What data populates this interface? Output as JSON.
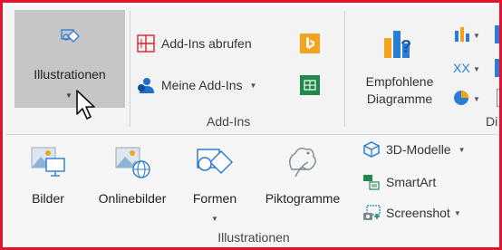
{
  "ribbon": {
    "illustrations_button": {
      "label": "Illustrationen",
      "icon": "illustration-icon"
    },
    "addins_group": {
      "label": "Add-Ins",
      "get_addins": {
        "label": "Add-Ins abrufen",
        "icon": "store-icon"
      },
      "my_addins": {
        "label": "Meine Add-Ins",
        "icon": "my-addins-icon"
      },
      "bing_icon": "bing-icon",
      "people_graph_icon": "people-graph-icon"
    },
    "charts_group": {
      "label_partial": "Di",
      "recommended_line1": "Empfohlene",
      "recommended_line2": "Diagramme"
    }
  },
  "illustrations_menu": {
    "group_label": "Illustrationen",
    "items": [
      {
        "label": "Bilder",
        "icon": "pictures-icon"
      },
      {
        "label": "Onlinebilder",
        "icon": "online-pictures-icon"
      },
      {
        "label": "Formen",
        "icon": "shapes-icon"
      },
      {
        "label": "Piktogramme",
        "icon": "icons-icon"
      }
    ],
    "side_items": [
      {
        "label": "3D-Modelle",
        "icon": "3d-models-icon"
      },
      {
        "label": "SmartArt",
        "icon": "smartart-icon"
      },
      {
        "label": "Screenshot",
        "icon": "screenshot-icon"
      }
    ]
  },
  "colors": {
    "frame": "#e8102a",
    "hover": "#c6c6c6",
    "accent_blue": "#2b7cd3",
    "orange": "#f4a31d"
  }
}
